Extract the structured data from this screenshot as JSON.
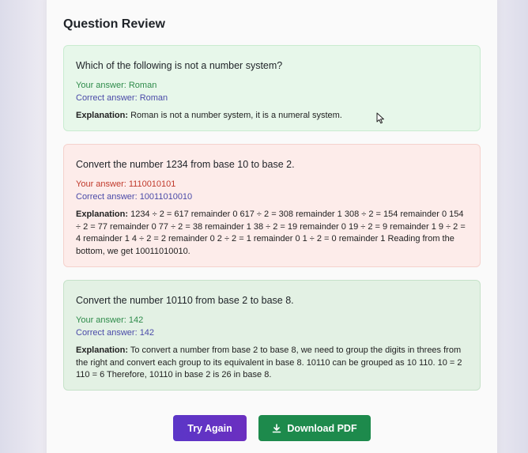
{
  "page": {
    "title": "Question Review"
  },
  "questions": [
    {
      "question": "Which of the following is not a number system?",
      "your_answer": "Your answer: Roman",
      "correct_answer": "Correct answer: Roman",
      "explanation_label": "Explanation:",
      "explanation": "Roman is not a number system, it is a numeral system.",
      "status": "correct"
    },
    {
      "question": "Convert the number 1234 from base 10 to base 2.",
      "your_answer": "Your answer: 1110010101",
      "correct_answer": "Correct answer: 10011010010",
      "explanation_label": "Explanation:",
      "explanation": "1234 ÷ 2 = 617 remainder 0 617 ÷ 2 = 308 remainder 1 308 ÷ 2 = 154 remainder 0 154 ÷ 2 = 77 remainder 0 77 ÷ 2 = 38 remainder 1 38 ÷ 2 = 19 remainder 0 19 ÷ 2 = 9 remainder 1 9 ÷ 2 = 4 remainder 1 4 ÷ 2 = 2 remainder 0 2 ÷ 2 = 1 remainder 0 1 ÷ 2 = 0 remainder 1 Reading from the bottom, we get 10011010010.",
      "status": "wrong"
    },
    {
      "question": "Convert the number 10110 from base 2 to base 8.",
      "your_answer": "Your answer: 142",
      "correct_answer": "Correct answer: 142",
      "explanation_label": "Explanation:",
      "explanation": "To convert a number from base 2 to base 8, we need to group the digits in threes from the right and convert each group to its equivalent in base 8. 10110 can be grouped as 10 110. 10 = 2 110 = 6 Therefore, 10110 in base 2 is 26 in base 8.",
      "status": "correct"
    }
  ],
  "buttons": {
    "try_again": "Try Again",
    "download_pdf": "Download PDF"
  },
  "icons": {
    "download": "download-icon",
    "cursor": "mouse-pointer-icon"
  },
  "colors": {
    "correct_bg": "#e7f7ea",
    "wrong_bg": "#fdecea",
    "try_again": "#5b36c7",
    "download": "#1d8a4c"
  }
}
